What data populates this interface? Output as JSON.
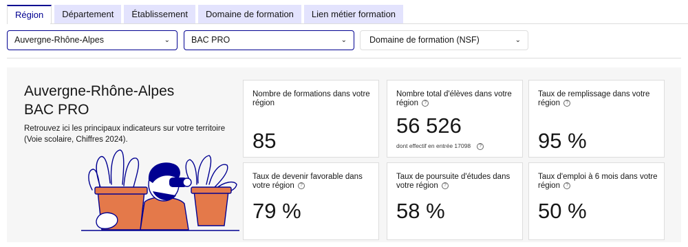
{
  "tabs": [
    {
      "label": "Région",
      "active": true
    },
    {
      "label": "Département"
    },
    {
      "label": "Établissement"
    },
    {
      "label": "Domaine de formation"
    },
    {
      "label": "Lien métier formation"
    }
  ],
  "filters": {
    "region": "Auvergne-Rhône-Alpes",
    "diploma": "BAC PRO",
    "domain_placeholder": "Domaine de formation (NSF)"
  },
  "summary": {
    "title_region": "Auvergne-Rhône-Alpes",
    "title_diploma": "BAC PRO",
    "description": "Retrouvez ici les principaux indicateurs sur votre territoire (Voie scolaire, Chiffres 2024)."
  },
  "indicators": [
    {
      "label": "Nombre de formations dans votre région",
      "value": "85",
      "help": false
    },
    {
      "label": "Nombre total d'élèves dans votre région",
      "value": "56 526",
      "help": true,
      "sub": "dont effectif en entrée 17098"
    },
    {
      "label": "Taux de remplissage dans votre région",
      "value": "95 %",
      "help": true
    },
    {
      "label": "Taux de devenir favorable dans votre région",
      "value": "79 %",
      "help": true
    },
    {
      "label": "Taux de poursuite d'études dans votre région",
      "value": "58 %",
      "help": true
    },
    {
      "label": "Taux d'emploi à 6 mois dans votre région",
      "value": "50 %",
      "help": true
    }
  ],
  "colors": {
    "accent": "#000091",
    "tab_bg": "#e3e3fd",
    "panel_bg": "#f6f6f6",
    "illus_orange": "#e4794a"
  },
  "icons": {
    "chevron": "chevron-down-icon",
    "help": "question-circle-icon"
  }
}
